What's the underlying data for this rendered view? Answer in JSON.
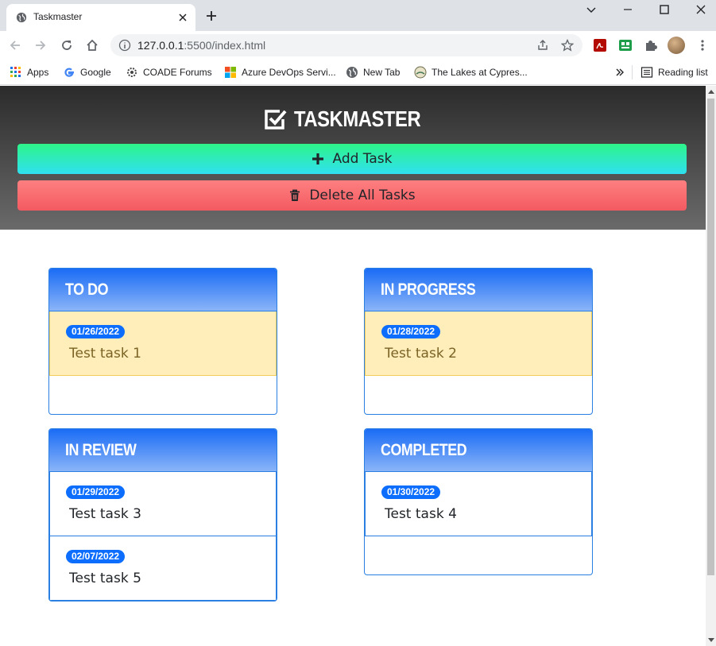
{
  "browser": {
    "tab_title": "Taskmaster",
    "url_host": "127.0.0.1",
    "url_rest": ":5500/index.html",
    "bookmarks": [
      {
        "label": "Apps",
        "icon": "apps-grid-icon"
      },
      {
        "label": "Google",
        "icon": "google-icon"
      },
      {
        "label": "COADE Forums",
        "icon": "gear-icon"
      },
      {
        "label": "Azure DevOps Servi...",
        "icon": "windows-icon"
      },
      {
        "label": "New Tab",
        "icon": "globe-icon"
      },
      {
        "label": "The Lakes at Cypres...",
        "icon": "site-icon"
      }
    ],
    "reading_list": "Reading list"
  },
  "app": {
    "title": "TASKMASTER",
    "add_label": "Add Task",
    "delete_label": "Delete All Tasks",
    "columns": [
      {
        "title": "TO DO",
        "tasks": [
          {
            "date": "01/26/2022",
            "text": "Test task 1",
            "status": "warn"
          }
        ]
      },
      {
        "title": "IN PROGRESS",
        "tasks": [
          {
            "date": "01/28/2022",
            "text": "Test task 2",
            "status": "warn"
          }
        ]
      },
      {
        "title": "IN REVIEW",
        "tasks": [
          {
            "date": "01/29/2022",
            "text": "Test task 3",
            "status": "normal"
          },
          {
            "date": "02/07/2022",
            "text": "Test task 5",
            "status": "normal"
          }
        ]
      },
      {
        "title": "COMPLETED",
        "tasks": [
          {
            "date": "01/30/2022",
            "text": "Test task 4",
            "status": "normal"
          }
        ]
      }
    ]
  },
  "colors": {
    "add_gradient": [
      "#2ef58a",
      "#2ee0f0"
    ],
    "delete_gradient": [
      "#fe7f80",
      "#f35a61"
    ],
    "column_head": [
      "#1a6cf5",
      "#8ab4f8"
    ],
    "badge": "#0d6efd",
    "overdue_bg": "#ffeeba"
  }
}
